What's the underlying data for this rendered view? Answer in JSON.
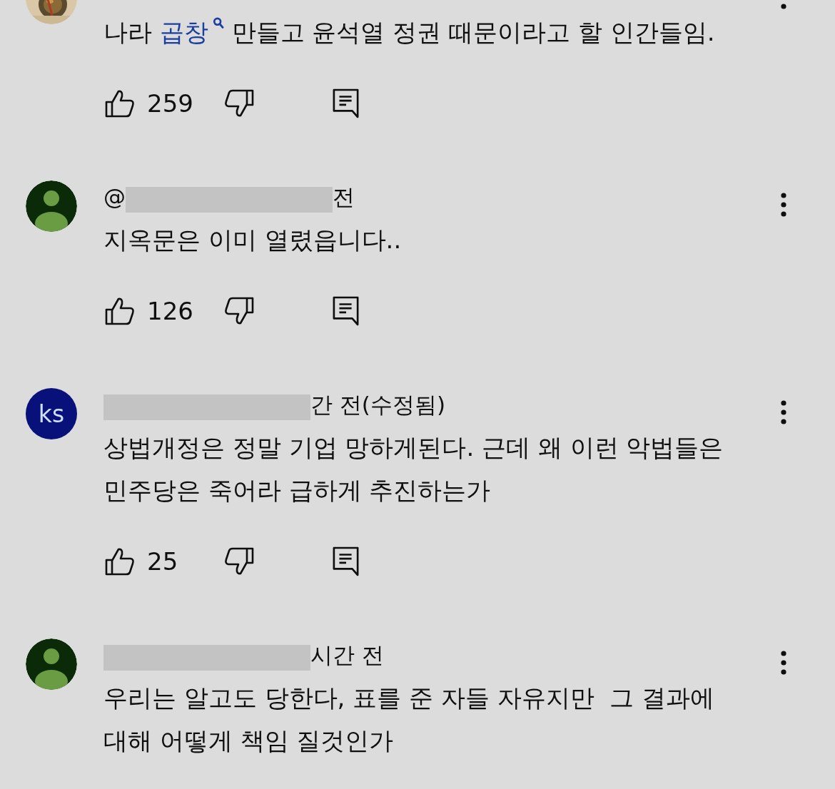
{
  "comments": [
    {
      "avatar": {
        "kind": "picture"
      },
      "body": [
        {
          "kind": "text",
          "text": "나라 "
        },
        {
          "kind": "search-link",
          "text": "곱창"
        },
        {
          "kind": "text",
          "text": " 만들고 윤석열 정권 때문이라고 할 인간들임."
        }
      ],
      "likes": "259"
    },
    {
      "avatar": {
        "kind": "silhouette"
      },
      "header": {
        "prefix": "@",
        "redacted": true,
        "text": "전"
      },
      "body": [
        {
          "kind": "text",
          "text": "지옥문은 이미 열렸읍니다.."
        }
      ],
      "likes": "126"
    },
    {
      "avatar": {
        "kind": "initials",
        "text": "ks"
      },
      "header": {
        "redacted": true,
        "text": "간 전(수정됨)"
      },
      "body": [
        {
          "kind": "text",
          "text": "상법개정은 정말 기업 망하게된다. 근데 왜 이런 악법들은 민주당은 죽어라 급하게 추진하는가"
        }
      ],
      "likes": "25"
    },
    {
      "avatar": {
        "kind": "silhouette"
      },
      "header": {
        "redacted": true,
        "text": "시간 전"
      },
      "body": [
        {
          "kind": "text",
          "text": "우리는 알고도 당한다, 표를 준 자들 자유지만  그 결과에 대해 어떻게 책임 질것인가"
        }
      ]
    }
  ]
}
